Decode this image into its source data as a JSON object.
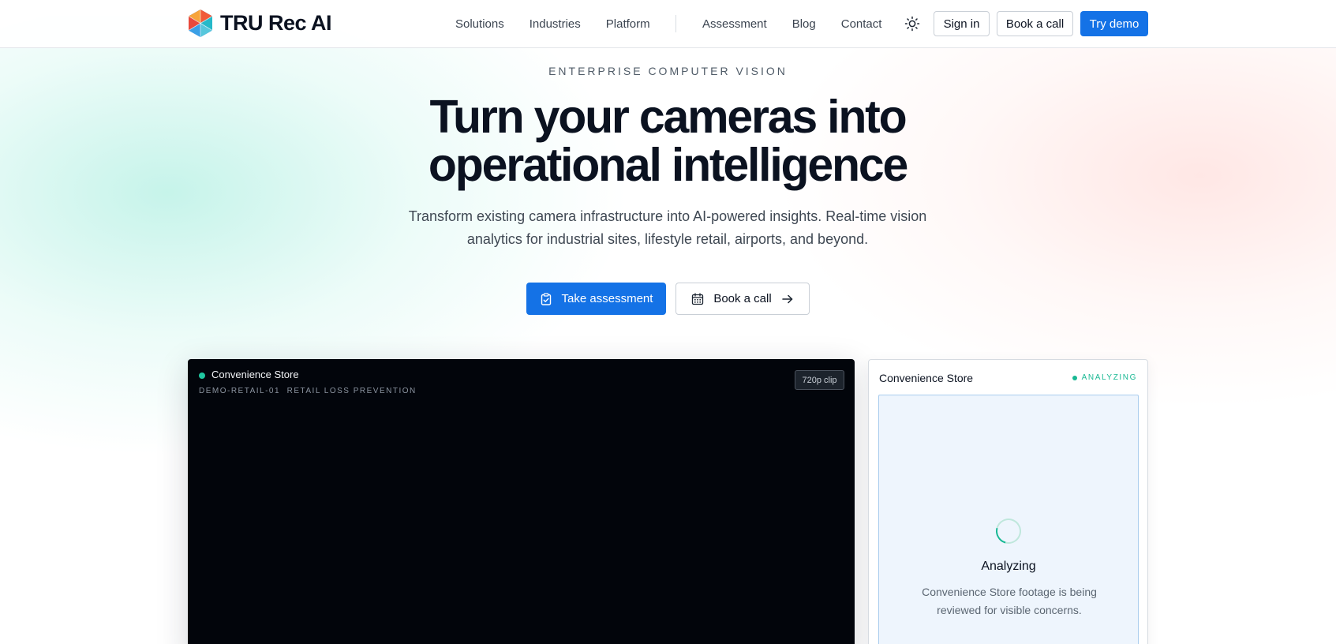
{
  "header": {
    "brand": "TRU Rec AI",
    "nav_primary": [
      {
        "label": "Solutions"
      },
      {
        "label": "Industries"
      },
      {
        "label": "Platform"
      }
    ],
    "nav_secondary": [
      {
        "label": "Assessment"
      },
      {
        "label": "Blog"
      },
      {
        "label": "Contact"
      }
    ],
    "theme_icon": "sun-icon",
    "sign_in": "Sign in",
    "book_call": "Book a call",
    "try_demo": "Try demo"
  },
  "hero": {
    "eyebrow": "ENTERPRISE COMPUTER VISION",
    "title_line1": "Turn your cameras into",
    "title_line2": "operational intelligence",
    "subtitle_line1": "Transform existing camera infrastructure into AI-powered insights. Real-time vision",
    "subtitle_line2": "analytics for industrial sites, lifestyle retail, airports, and beyond.",
    "cta_primary": "Take assessment",
    "cta_primary_icon": "clipboard-check-icon",
    "cta_secondary": "Book a call",
    "cta_secondary_icon": "calendar-icon",
    "cta_secondary_trailing_icon": "arrow-right-icon"
  },
  "video": {
    "title": "Convenience Store",
    "meta": "DEMO-RETAIL-01  RETAIL LOSS PREVENTION",
    "badge": "720p clip",
    "status_color": "#1fc7a0"
  },
  "analysis": {
    "title": "Convenience Store",
    "status": "ANALYZING",
    "heading": "Analyzing",
    "desc_line1": "Convenience Store footage is being",
    "desc_line2": "reviewed for visible concerns.",
    "accent": "#18b893"
  },
  "colors": {
    "primary": "#1472e6",
    "text": "#0b1220"
  }
}
